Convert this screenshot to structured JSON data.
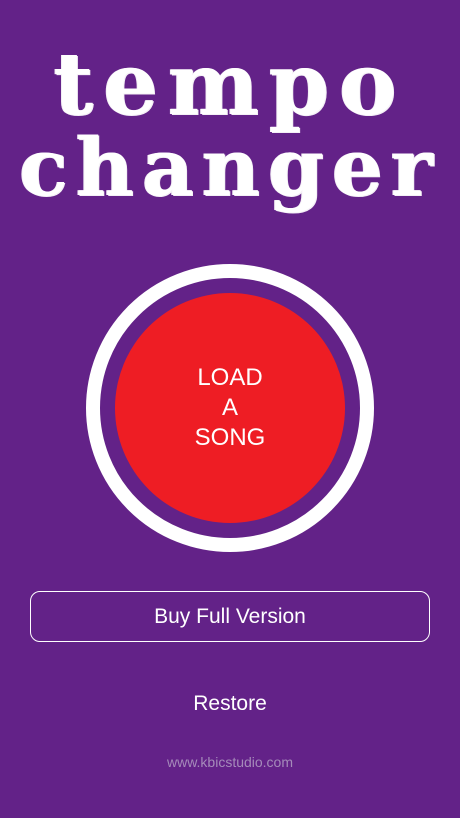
{
  "app": {
    "logo_line1": "tempo",
    "logo_line2": "changer"
  },
  "main": {
    "load_button": {
      "line1": "LOAD",
      "line2": "A",
      "line3": "SONG"
    },
    "buy_label": "Buy Full Version",
    "restore_label": "Restore"
  },
  "footer": {
    "website": "www.kbicstudio.com"
  },
  "colors": {
    "background": "#632288",
    "load_button": "#ee1d24",
    "ring": "#ffffff",
    "text": "#ffffff",
    "footer_text": "#a58bba"
  }
}
